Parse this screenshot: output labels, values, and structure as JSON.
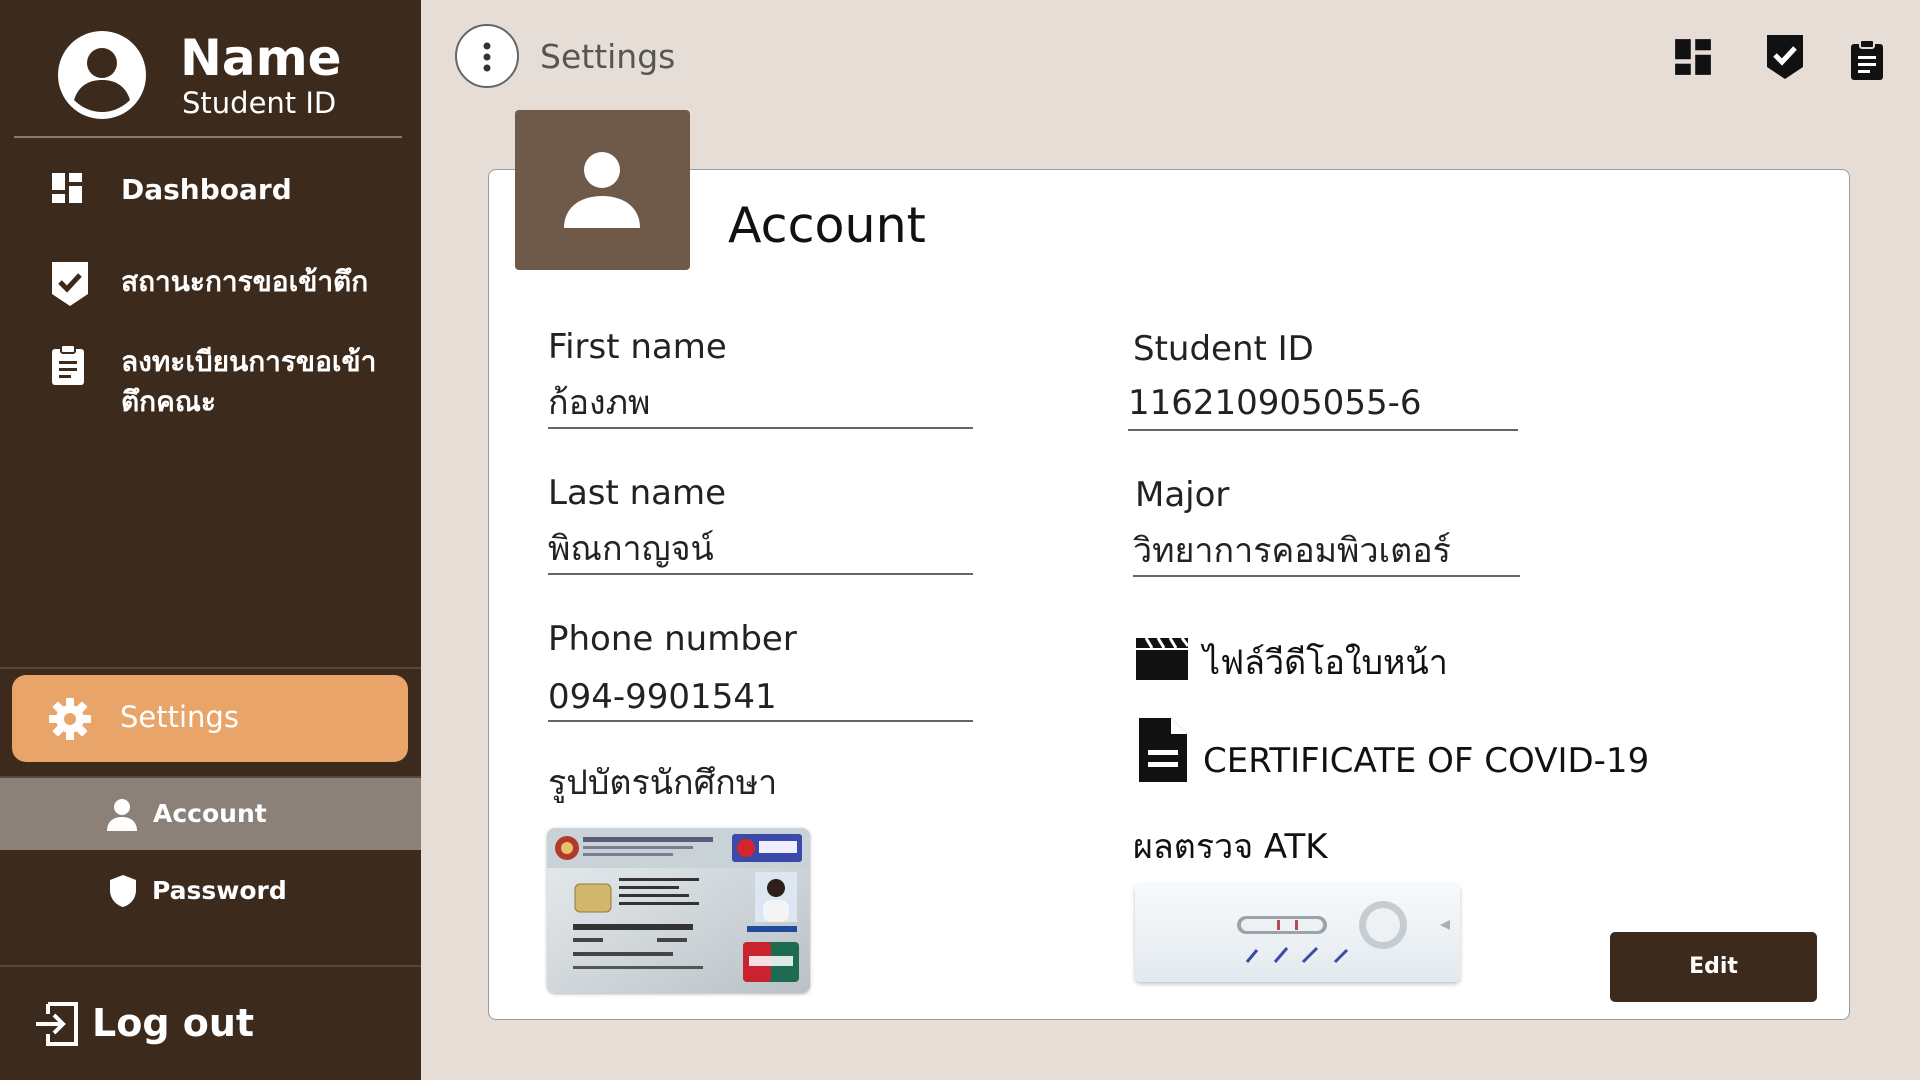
{
  "profile": {
    "name": "Name",
    "student_id_label": "Student ID"
  },
  "sidebar": {
    "items": [
      {
        "label": "Dashboard",
        "icon": "dashboard-icon"
      },
      {
        "label": "สถานะการขอเข้าตึก",
        "icon": "checkmark-badge-icon"
      },
      {
        "label_line1": "ลงทะเบียนการขอเข้า",
        "label_line2": "ตึกคณะ",
        "icon": "clipboard-icon"
      }
    ],
    "settings": {
      "label": "Settings",
      "icon": "gear-icon"
    },
    "sub_items": [
      {
        "label": "Account",
        "icon": "person-icon"
      },
      {
        "label": "Password",
        "icon": "shield-icon"
      }
    ],
    "logout": {
      "label": "Log out",
      "icon": "logout-icon"
    }
  },
  "topbar": {
    "title": "Settings",
    "icons": [
      "dashboard-icon",
      "checkmark-badge-icon",
      "clipboard-icon"
    ]
  },
  "account": {
    "title": "Account",
    "first_name": {
      "label": "First name",
      "value": "ก้องภพ"
    },
    "last_name": {
      "label": "Last name",
      "value": "พิณกาญจน์"
    },
    "phone": {
      "label": "Phone number",
      "value": "094-9901541"
    },
    "student_card": {
      "label": "รูปบัตรนักศึกษา"
    },
    "student_id": {
      "label": "Student ID",
      "value": "116210905055-6"
    },
    "major": {
      "label": "Major",
      "value": "วิทยาการคอมพิวเตอร์"
    },
    "face_video": {
      "label": "ไฟล์วีดีโอใบหน้า",
      "icon": "video-clapper-icon"
    },
    "covid_cert": {
      "label": "CERTIFICATE OF COVID-19",
      "icon": "document-icon"
    },
    "atk": {
      "label": "ผลตรวจ ATK"
    },
    "edit_label": "Edit"
  },
  "colors": {
    "sidebar_bg": "#3c2a1c",
    "accent": "#e9a46a",
    "page_bg": "#e6ddd6",
    "badge": "#6f5a4a"
  }
}
